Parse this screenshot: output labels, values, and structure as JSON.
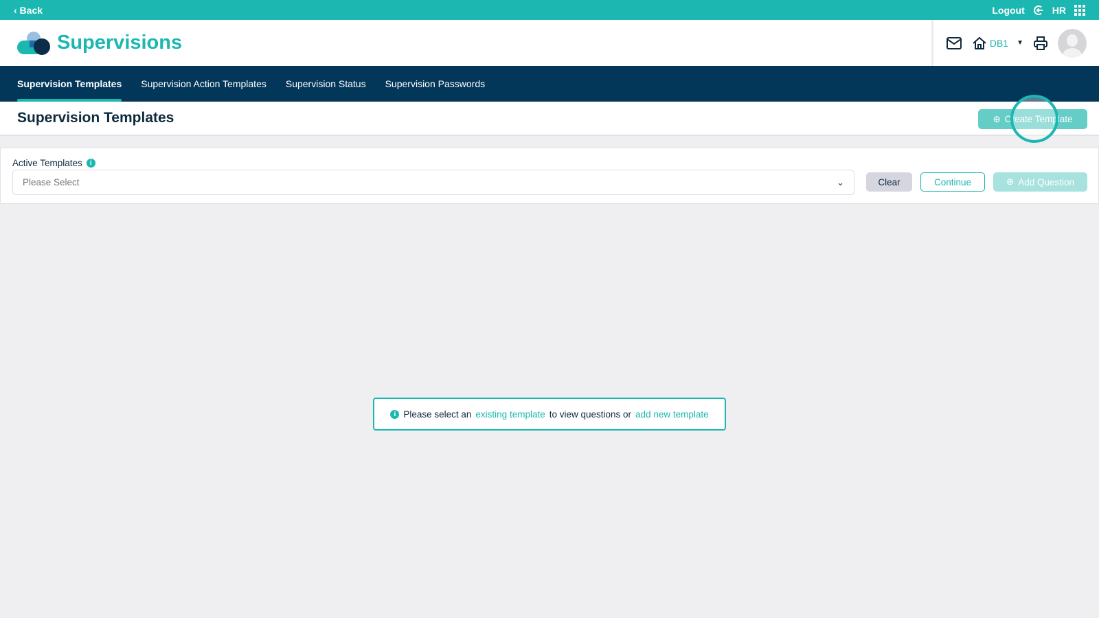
{
  "topbar": {
    "back": "‹ Back",
    "logout": "Logout",
    "user_initials": "HR"
  },
  "header": {
    "title": "Supervisions",
    "location": "DB1"
  },
  "nav": {
    "tabs": [
      {
        "label": "Supervision Templates"
      },
      {
        "label": "Supervision Action Templates"
      },
      {
        "label": "Supervision Status"
      },
      {
        "label": "Supervision Passwords"
      }
    ]
  },
  "page": {
    "title": "Supervision Templates",
    "create_button": "Create Template"
  },
  "form": {
    "label": "Active Templates",
    "placeholder": "Please Select",
    "clear": "Clear",
    "continue": "Continue",
    "add_question": "Add Question"
  },
  "message": {
    "part1": "Please select an",
    "link1": "existing template",
    "part2": "to view questions or",
    "link2": "add new template"
  }
}
